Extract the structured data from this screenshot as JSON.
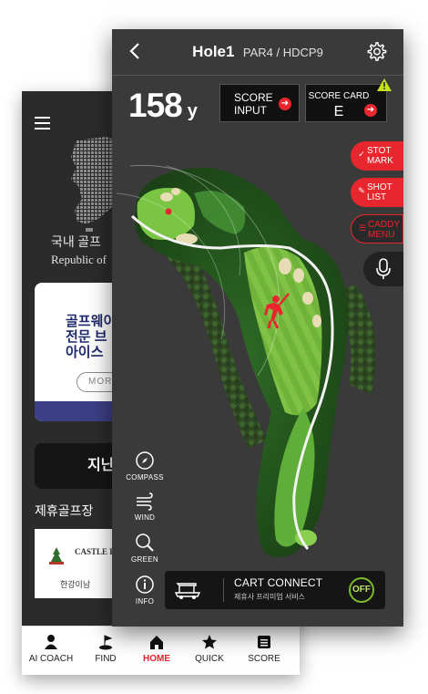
{
  "back_screen": {
    "region": {
      "korean": "국내 골프",
      "english": "Republic of"
    },
    "promo": {
      "lines": [
        "골프웨이",
        "전문 브",
        "아이스"
      ],
      "more_label": "MORE VI"
    },
    "past_button_label": "지난",
    "partner_section_title": "제휴골프장",
    "partner": {
      "name": "CASTLE PINE",
      "label": "한강이남"
    },
    "nav": [
      {
        "label": "AI COACH",
        "icon": "person-icon"
      },
      {
        "label": "FIND",
        "icon": "flag-icon"
      },
      {
        "label": "HOME",
        "icon": "home-icon",
        "active": true
      },
      {
        "label": "QUICK",
        "icon": "star-icon"
      },
      {
        "label": "SCORE",
        "icon": "scorecard-icon"
      }
    ]
  },
  "header": {
    "hole": "Hole1",
    "info": "PAR4 / HDCP9"
  },
  "distance": {
    "value": "158",
    "unit": "y"
  },
  "score_input": {
    "line1": "SCORE",
    "line2": "INPUT"
  },
  "score_card": {
    "label": "SCORE CARD",
    "value": "E"
  },
  "side_buttons": {
    "stot": {
      "line1": "STOT",
      "line2": "MARK"
    },
    "shot": {
      "line1": "SHOT",
      "line2": "LIST"
    },
    "caddy": {
      "line1": "CADDY",
      "line2": "MENU"
    }
  },
  "tools": {
    "compass": "COMPASS",
    "wind": "WIND",
    "green": "GREEN",
    "info": "INFO"
  },
  "cart": {
    "title": "CART CONNECT",
    "subtitle": "제휴사 프리미엄 서비스",
    "toggle": "OFF"
  },
  "colors": {
    "accent": "#e8262d",
    "fairway": "#3f9c2e",
    "toggle": "#7dbb2b"
  }
}
